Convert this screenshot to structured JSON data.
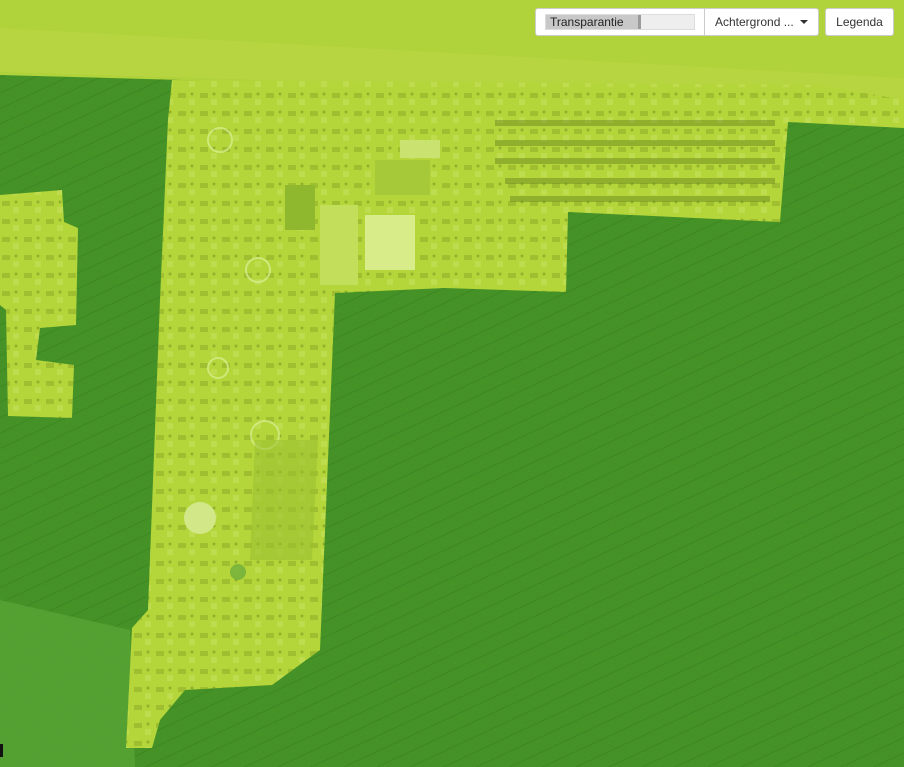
{
  "toolbar": {
    "transparency_label": "Transparantie",
    "transparency_value": 0.62,
    "background_label": "Achtergrond ...",
    "legend_label": "Legenda"
  },
  "map": {
    "base_color": "#3f8f22",
    "highlight_color": "#b5d63a",
    "dark_patch_color": "#2f7a1a"
  }
}
